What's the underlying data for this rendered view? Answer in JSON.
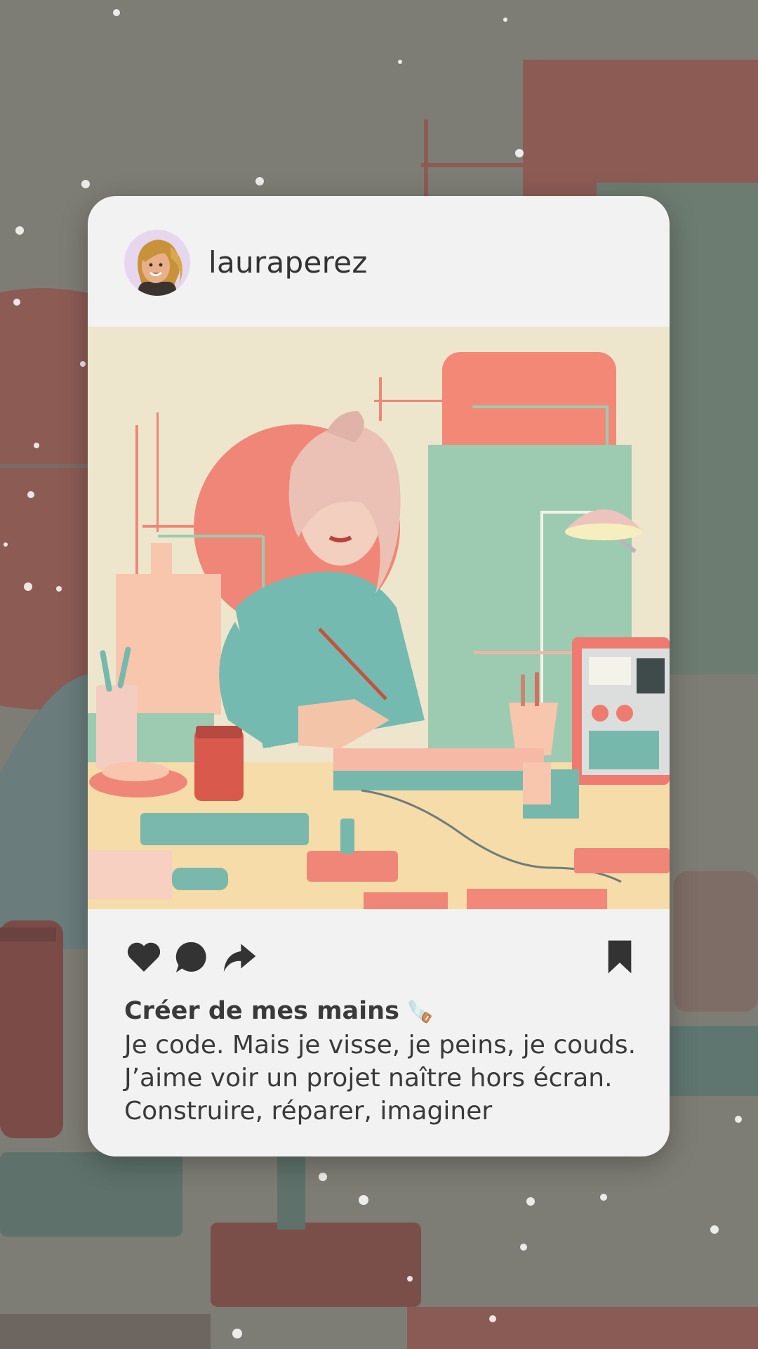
{
  "post": {
    "username": "lauraperez",
    "caption_title": "Créer de mes mains",
    "caption_title_emoji": "🪚",
    "caption_lines": [
      "Je code. Mais je visse, je peins, je couds.",
      "J’aime voir un projet naître hors écran.",
      "Construire, réparer, imaginer"
    ]
  },
  "actions": {
    "like_icon": "heart-icon",
    "comment_icon": "comment-icon",
    "share_icon": "share-icon",
    "save_icon": "bookmark-icon"
  },
  "colors": {
    "background": "#7e7d75",
    "card": "#f2f2f2",
    "coral": "#f08677",
    "mint": "#9ccbb1",
    "teal": "#77b8ad",
    "cream": "#ede6cc",
    "text": "#3a3a3a"
  }
}
